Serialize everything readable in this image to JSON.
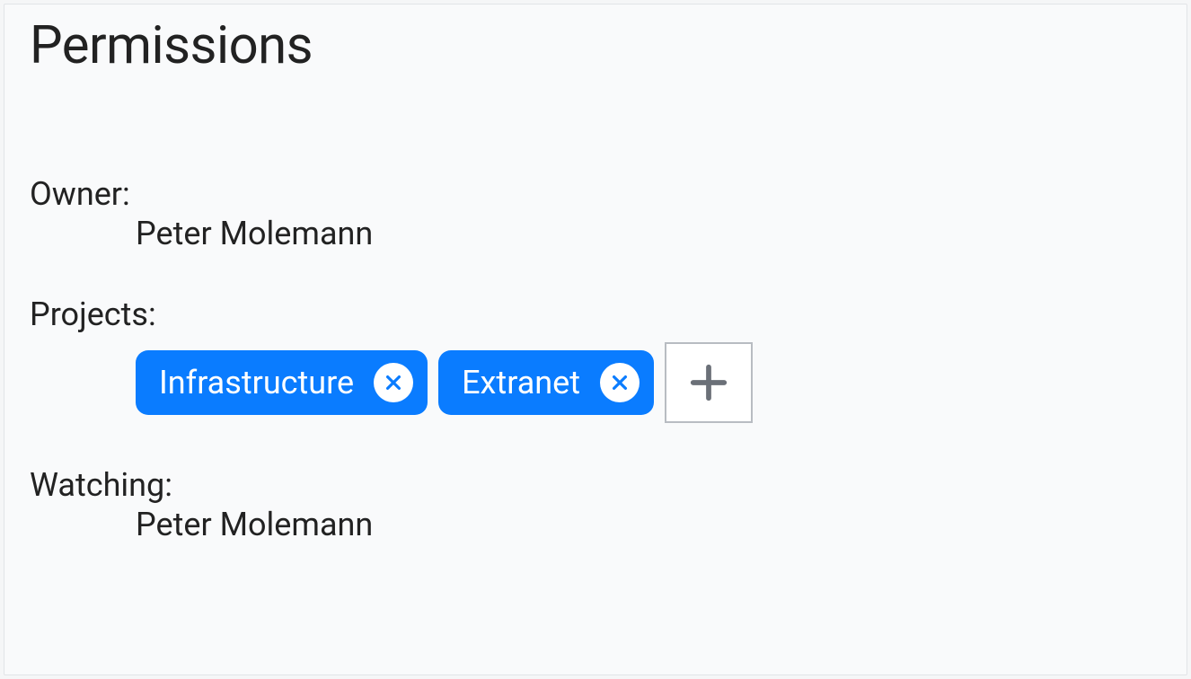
{
  "panel": {
    "title": "Permissions",
    "owner": {
      "label": "Owner:",
      "value": "Peter Molemann"
    },
    "projects": {
      "label": "Projects:",
      "chips": [
        {
          "label": "Infrastructure"
        },
        {
          "label": "Extranet"
        }
      ]
    },
    "watching": {
      "label": "Watching:",
      "value": "Peter Molemann"
    }
  }
}
